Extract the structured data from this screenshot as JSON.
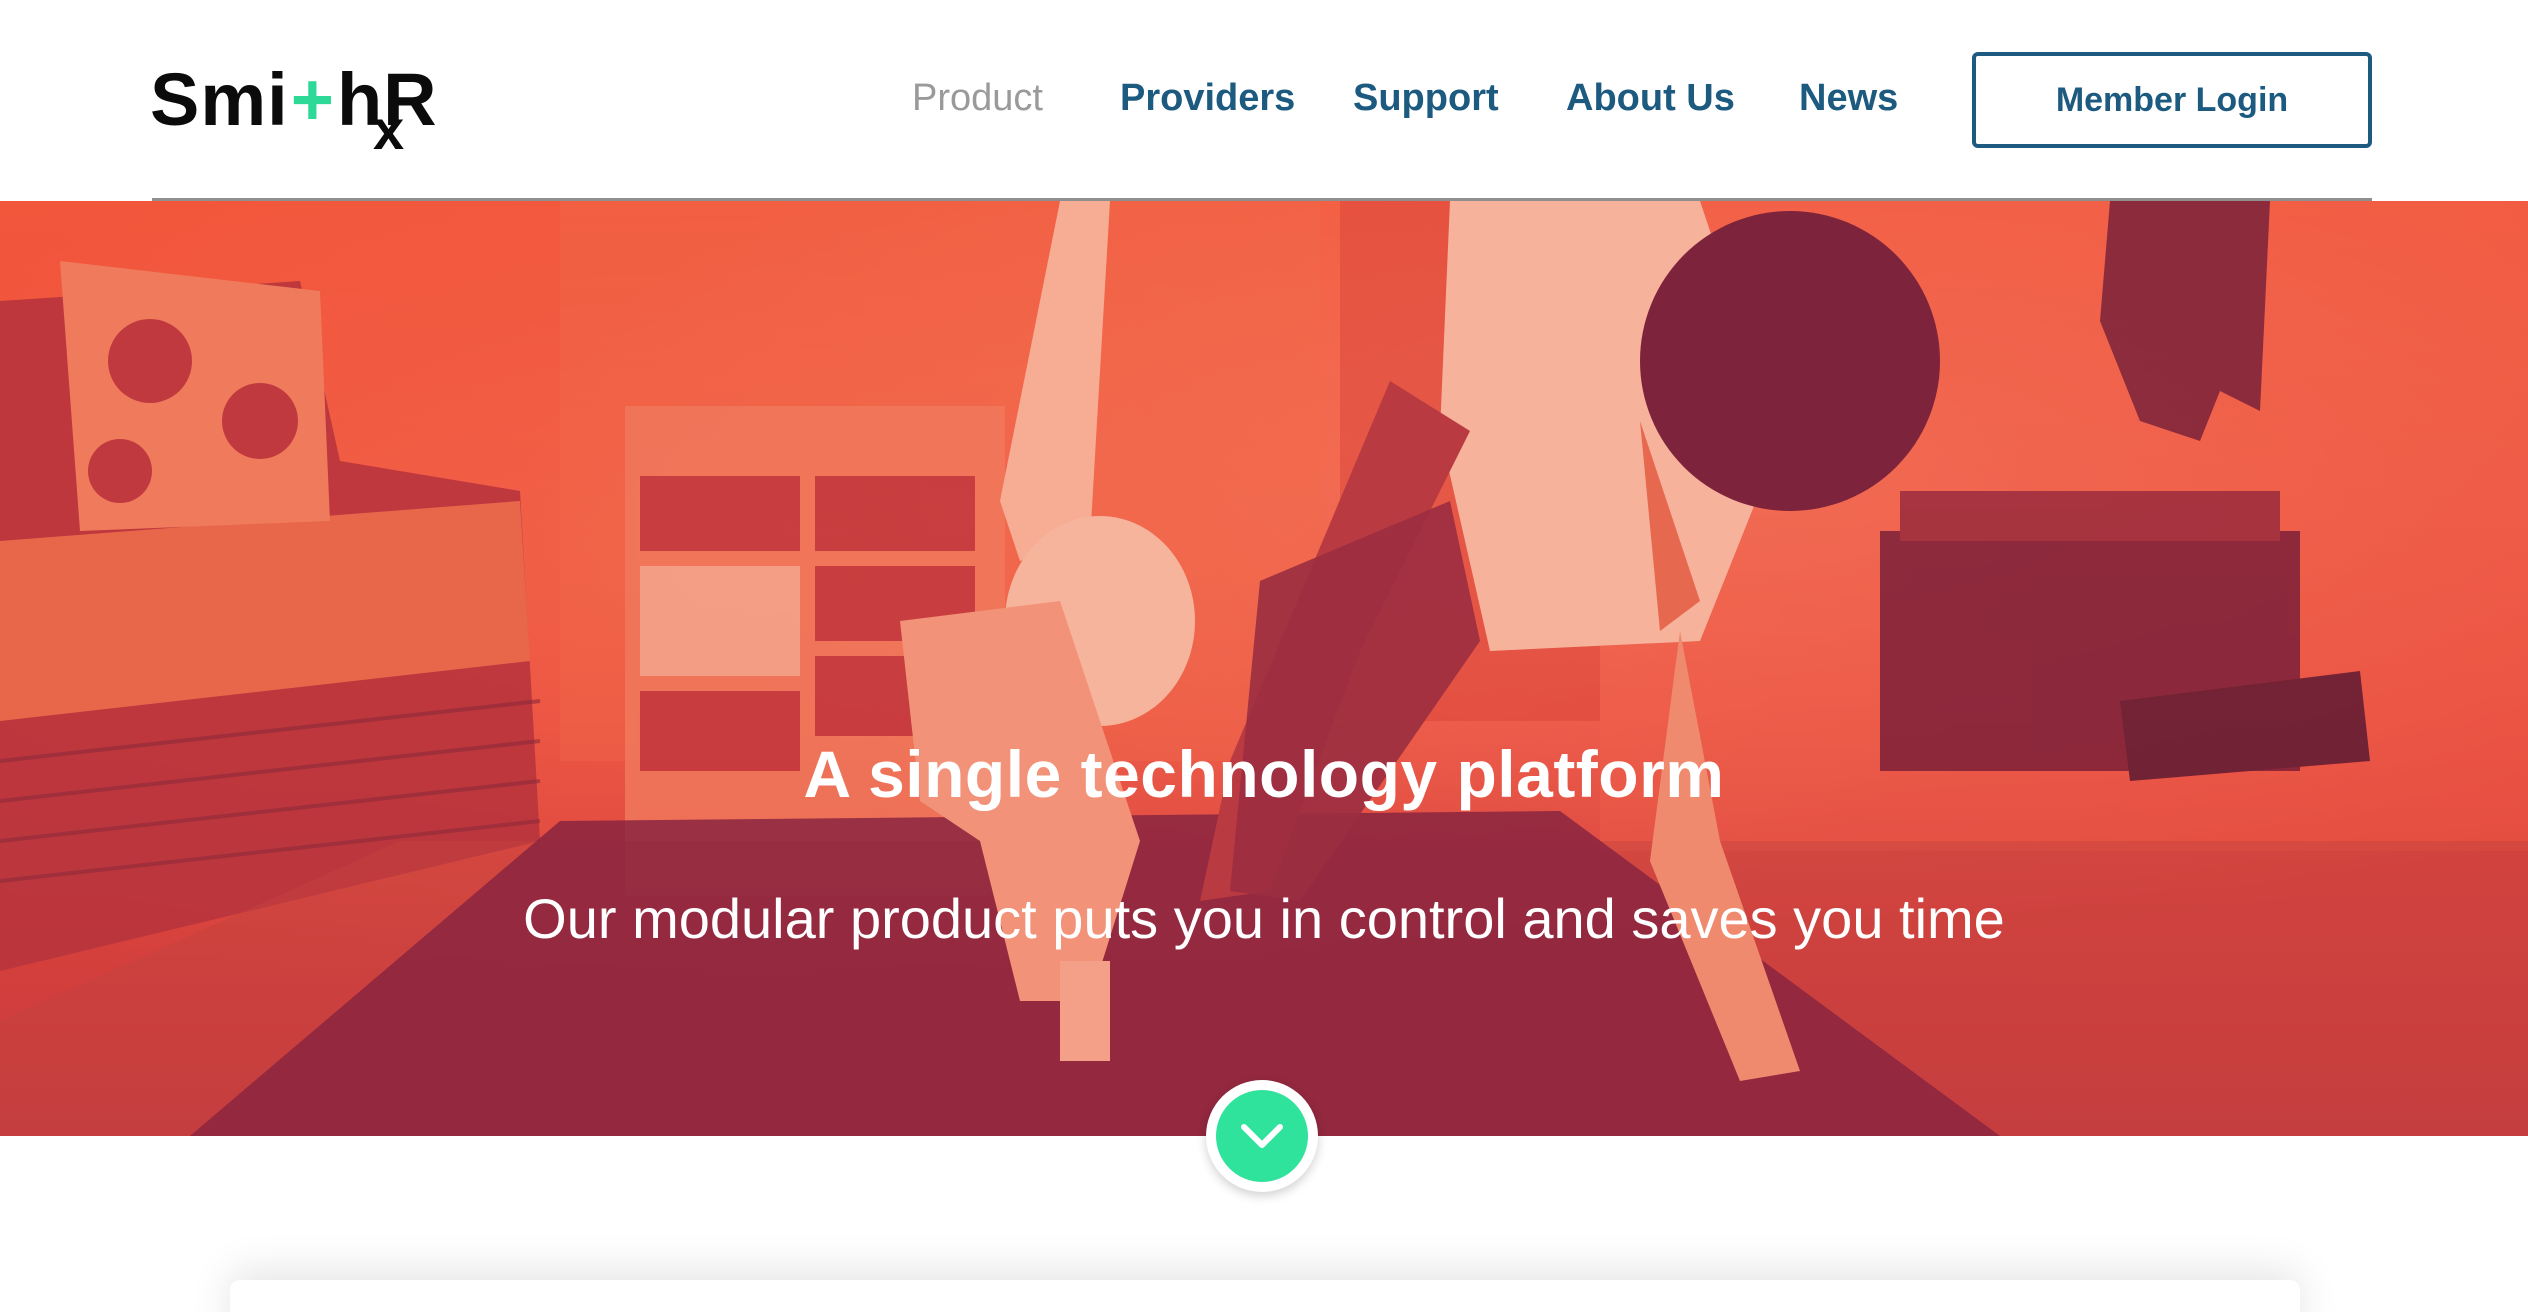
{
  "brand": {
    "logo_text_a": "Smi",
    "logo_plus": "+",
    "logo_text_b": "hR",
    "logo_text_x": "x",
    "accent_color": "#2ed896",
    "primary_color": "#1d5a80"
  },
  "nav": {
    "items": [
      {
        "label": "Product",
        "state": "current"
      },
      {
        "label": "Providers"
      },
      {
        "label": "Support"
      },
      {
        "label": "About Us"
      },
      {
        "label": "News"
      }
    ],
    "login_label": "Member Login"
  },
  "hero": {
    "title": "A single technology platform",
    "subtitle": "Our modular product puts you in control and saves you time",
    "overlay_color": "#f2563b",
    "scroll_icon": "chevron-down-icon"
  }
}
